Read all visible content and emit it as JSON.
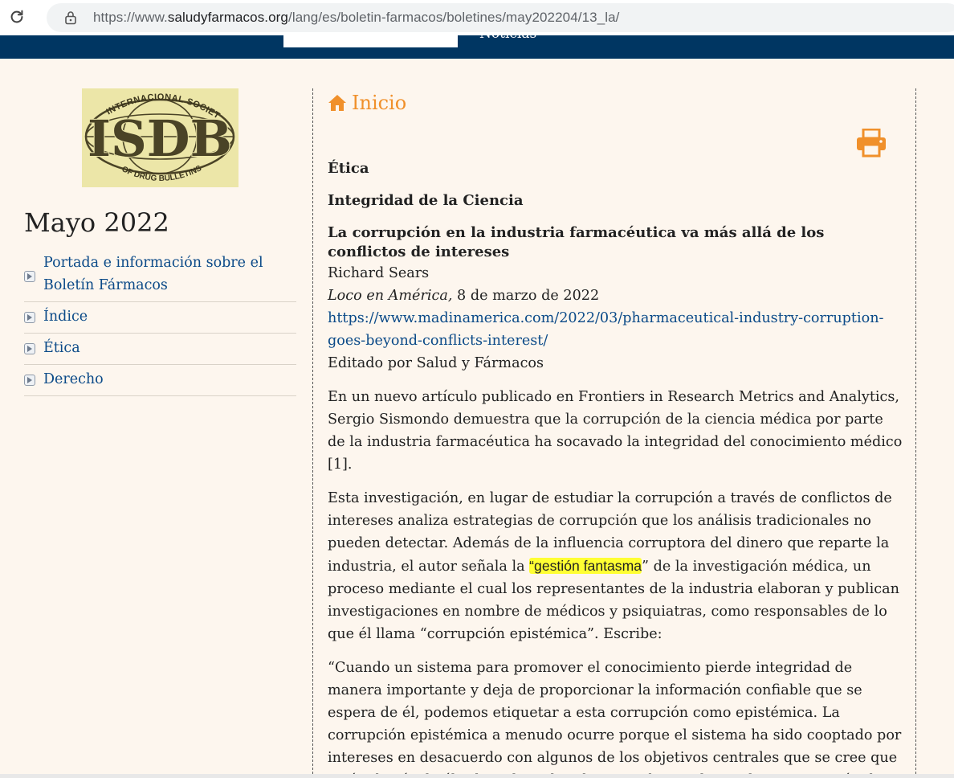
{
  "browser": {
    "url_prefix": "https://www.",
    "url_host": "saludyfarmacos.org",
    "url_path": "/lang/es/boletin-farmacos/boletines/may202204/13_la/"
  },
  "header": {
    "nav_partial": "Noticias"
  },
  "sidebar": {
    "logo_alt": "International Society of Drug Bulletins",
    "month_title": "Mayo 2022",
    "items": [
      {
        "label": "Portada e información sobre el Boletín Fármacos"
      },
      {
        "label": "Índice"
      },
      {
        "label": "Ética"
      },
      {
        "label": "Derecho"
      }
    ]
  },
  "main": {
    "home_label": "Inicio",
    "section": "Ética",
    "subsection": "Integridad de la Ciencia",
    "article_title": "La corrupción en la industria farmacéutica va más allá de los conflictos de intereses",
    "author": "Richard Sears",
    "source_name": "Loco en América,",
    "source_date": " 8 de marzo de 2022",
    "source_link": "https://www.madinamerica.com/2022/03/pharmaceutical-industry-corruption-goes-beyond-conflicts-interest/",
    "edited_by": "Editado por Salud y Fármacos",
    "para1": "En un nuevo artículo publicado en Frontiers in Research Metrics and Analytics, Sergio Sismondo demuestra que la corrupción de la ciencia médica por parte de la industria farmacéutica ha socavado la integridad del conocimiento médico [1].",
    "para2_before": "Esta investigación, en lugar de estudiar la corrupción a través de conflictos de intereses analiza estrategias de corrupción que los análisis tradicionales no pueden detectar. Además de la influencia corruptora del dinero que reparte la industria, el autor señala la ",
    "para2_highlight": "“gestión fantasma",
    "para2_after": "” de la investigación médica, un proceso mediante el cual los representantes de la industria elaboran y publican investigaciones en nombre de médicos y psiquiatras, como responsables de lo que él llama “corrupción epistémica”. Escribe:",
    "para3": "“Cuando un sistema para promover el conocimiento pierde integridad de manera importante y deja de proporcionar la información confiable que se espera de él, podemos etiquetar a esta corrupción como epistémica. La corrupción epistémica a menudo ocurre porque el sistema ha sido cooptado por intereses en desacuerdo con algunos de los objetivos centrales que se cree que están detrás de él. Ahora hay abundante evidencia de que la participación de las compañías"
  },
  "colors": {
    "header_bg": "#003662",
    "page_bg": "#fdf6ee",
    "accent": "#f0902b",
    "link": "#0b4a88",
    "highlight": "#ffff33"
  }
}
